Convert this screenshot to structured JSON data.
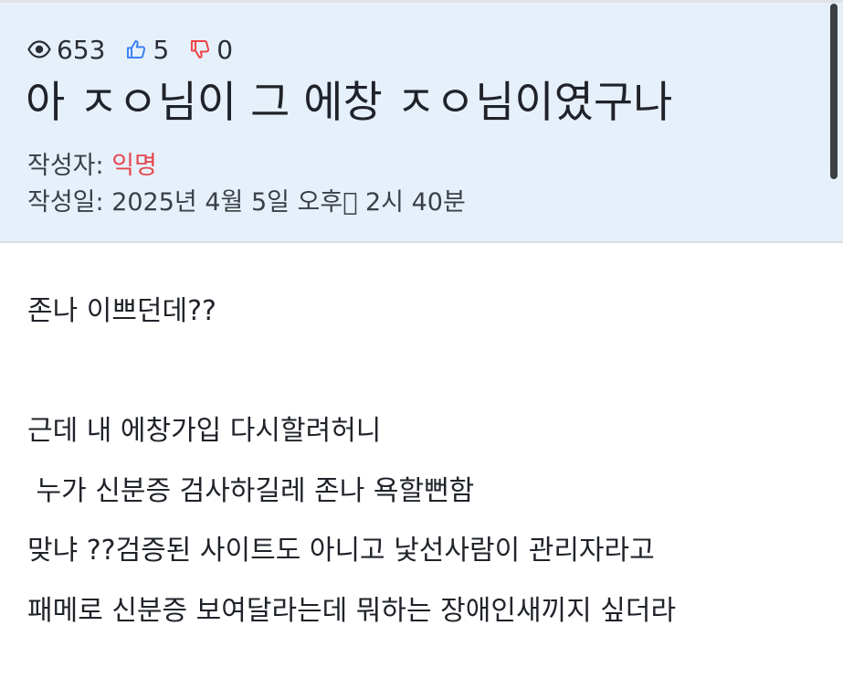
{
  "stats": {
    "views": "653",
    "likes": "5",
    "dislikes": "0",
    "icons": [
      "eye-icon",
      "thumbs-up-icon",
      "thumbs-down-icon"
    ],
    "like_color": "#3b82f6",
    "dislike_color": "#ef4444"
  },
  "post": {
    "title": "아 ㅈㅇ님이 그 에창 ㅈㅇ님이였구나",
    "author_label": "작성자: ",
    "author_name": "익명",
    "date_label": "작성일: ",
    "date_value": "2025년 4월 5일 오후\u0000 2시 40분",
    "author_color": "#e5484d"
  },
  "content": {
    "lines": [
      "존나 이쁘던데??",
      "근데 내 에창가입 다시할려허니",
      " 누가 신분증 검사하길레 존나 욕할뻔함",
      "맞냐 ??검증된 사이트도 아니고 낯선사람이 관리자라고",
      "패메로 신분증 보여달라는데 뭐하는 장애인새끼지 싶더라"
    ]
  }
}
